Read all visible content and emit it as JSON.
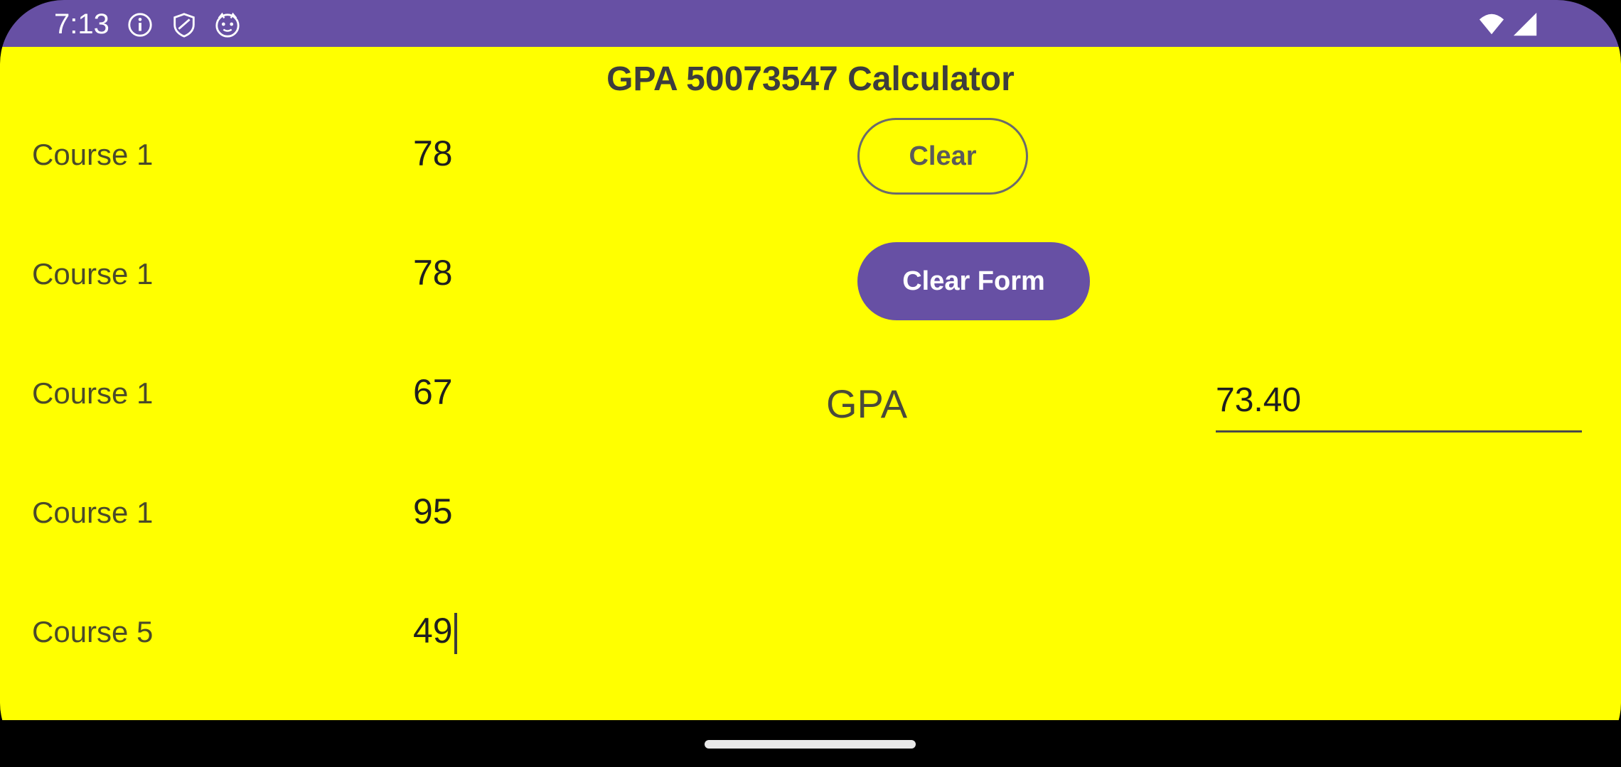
{
  "status_bar": {
    "time": "7:13",
    "icons": [
      "info-icon",
      "shield-icon",
      "cat-face-icon",
      "wifi-icon",
      "signal-icon"
    ],
    "background": "#6750A4"
  },
  "app": {
    "title": "GPA 50073547 Calculator",
    "background": "#FFFF00",
    "accent": "#6750A4"
  },
  "courses": [
    {
      "label": "Course 1",
      "value": "78"
    },
    {
      "label": "Course 1",
      "value": "78"
    },
    {
      "label": "Course 1",
      "value": "67"
    },
    {
      "label": "Course 1",
      "value": "95"
    },
    {
      "label": "Course 5",
      "value": "49"
    }
  ],
  "buttons": {
    "clear_label": "Clear",
    "clear_form_label": "Clear Form"
  },
  "result": {
    "label": "GPA",
    "value": "73.40"
  }
}
